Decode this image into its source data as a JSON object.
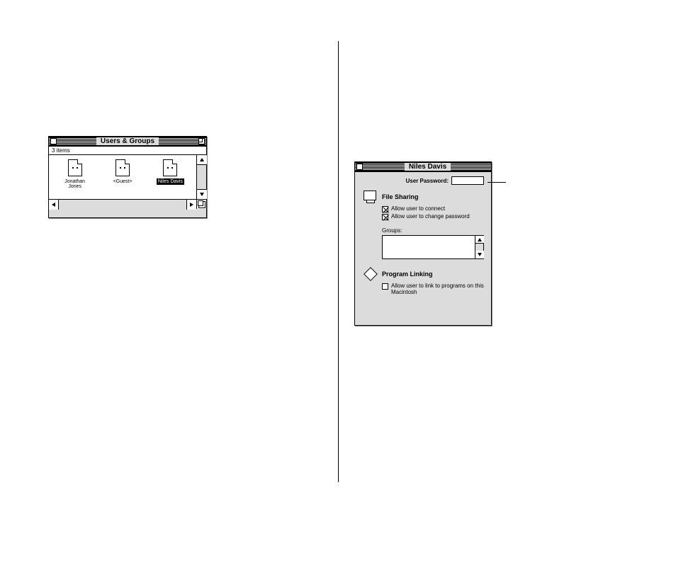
{
  "users_groups": {
    "title": "Users & Groups",
    "count_text": "3 items",
    "items": [
      {
        "label": "Jonathan Jones",
        "selected": false
      },
      {
        "label": "<Guest>",
        "selected": false
      },
      {
        "label": "Niles Davis",
        "selected": true
      }
    ]
  },
  "user_window": {
    "title": "Niles Davis",
    "password_label": "User Password:",
    "password_value": "",
    "file_sharing": {
      "heading": "File Sharing",
      "opt_connect": {
        "label": "Allow user to connect",
        "checked": true
      },
      "opt_change_pw": {
        "label": "Allow user to change password",
        "checked": true
      },
      "groups_label": "Groups:"
    },
    "program_linking": {
      "heading": "Program Linking",
      "opt_link": {
        "label": "Allow user to link to programs on this Macintosh",
        "checked": false
      }
    }
  }
}
